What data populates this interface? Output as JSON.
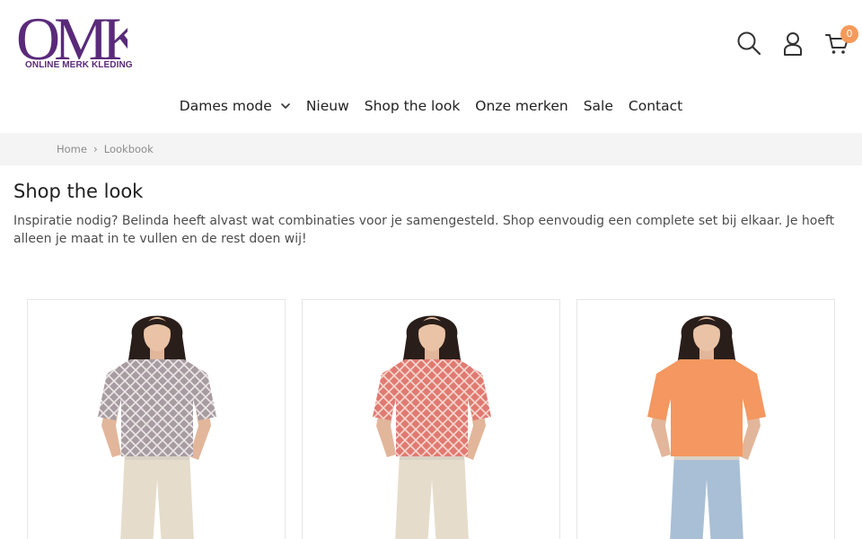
{
  "brand": {
    "logo_letters": "OMK",
    "logo_tagline": "ONLINE MERK KLEDING",
    "primary_color": "#5a2a7a",
    "accent_color": "#f59a5a"
  },
  "header": {
    "icons": [
      "search-icon",
      "user-icon",
      "cart-icon"
    ],
    "cart_count": "0"
  },
  "nav": {
    "items": [
      {
        "label": "Dames mode",
        "has_dropdown": true
      },
      {
        "label": "Nieuw",
        "has_dropdown": false
      },
      {
        "label": "Shop the look",
        "has_dropdown": false
      },
      {
        "label": "Onze merken",
        "has_dropdown": false
      },
      {
        "label": "Sale",
        "has_dropdown": false
      },
      {
        "label": "Contact",
        "has_dropdown": false
      }
    ]
  },
  "breadcrumb": {
    "items": [
      "Home",
      "Lookbook"
    ]
  },
  "main": {
    "title": "Shop the look",
    "intro": "Inspiratie nodig? Belinda heeft alvast wat combinaties voor je samengesteld. Shop eenvoudig een complete set bij elkaar. Je hoeft alleen je maat in te vullen en de rest doen wij!"
  },
  "looks": [
    {
      "top_color": "#a79ca1",
      "pattern_color": "#ece6e6",
      "pants_color": "#e5dccb"
    },
    {
      "top_color": "#e07a72",
      "pattern_color": "#f5d8cf",
      "pants_color": "#e6dccb"
    },
    {
      "top_color": "#f49760",
      "pattern_color": "#f49760",
      "pants_color": "#a9bfd6"
    }
  ]
}
